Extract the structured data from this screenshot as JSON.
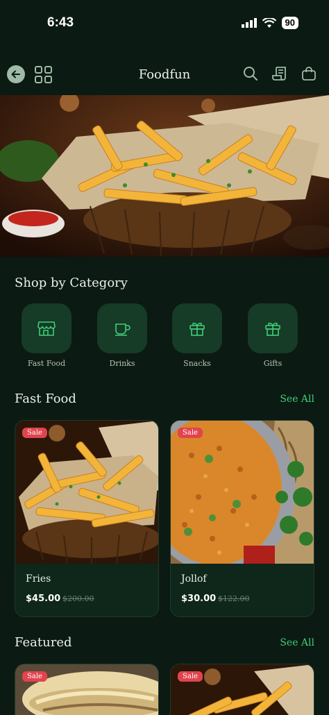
{
  "status": {
    "time": "6:43",
    "battery": "90"
  },
  "header": {
    "title": "Foodfun"
  },
  "categories_section": {
    "title": "Shop by Category",
    "items": [
      {
        "label": "Fast Food",
        "icon": "store-icon"
      },
      {
        "label": "Drinks",
        "icon": "cup-icon"
      },
      {
        "label": "Snacks",
        "icon": "gift-icon"
      },
      {
        "label": "Gifts",
        "icon": "gift-icon"
      }
    ]
  },
  "fast_food": {
    "title": "Fast Food",
    "see_all": "See All",
    "items": [
      {
        "badge": "Sale",
        "name": "Fries",
        "price": "$45.00",
        "old_price": "$200.00"
      },
      {
        "badge": "Sale",
        "name": "Jollof",
        "price": "$30.00",
        "old_price": "$122.00"
      }
    ]
  },
  "featured": {
    "title": "Featured",
    "see_all": "See All",
    "items": [
      {
        "badge": "Sale"
      },
      {
        "badge": "Sale"
      }
    ]
  },
  "colors": {
    "background": "#0b1a12",
    "accent": "#3ed07a",
    "tile": "#163b27",
    "sale": "#e0444d"
  }
}
